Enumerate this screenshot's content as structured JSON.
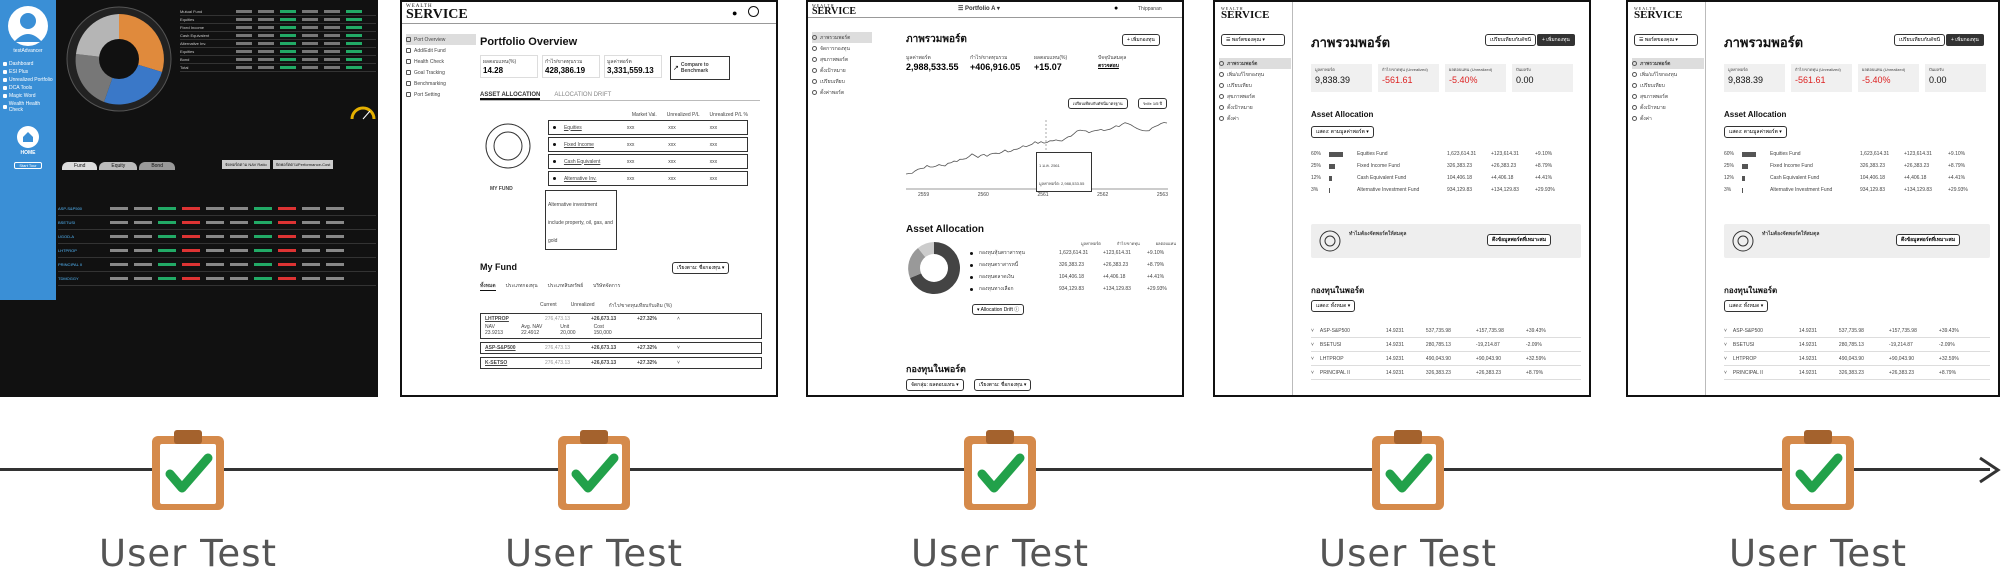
{
  "steps": [
    {
      "label": "User Test"
    },
    {
      "label": "User Test"
    },
    {
      "label": "User Test"
    },
    {
      "label": "User Test"
    },
    {
      "label": "User Test"
    }
  ],
  "colors": {
    "timeline": "#333333",
    "label_text": "#555555",
    "clipboard_body": "#d58a4b",
    "clipboard_paper": "#ffffff",
    "check": "#22a14a",
    "dark_app_bg": "#111111",
    "sidebar_blue": "#3a8fd6",
    "accent_red": "#dd2222"
  },
  "mock1": {
    "user": "testAdvancer",
    "nav": [
      "Dashboard",
      "ESI Plus",
      "Unrealized Portfolio",
      "DCA Tools",
      "Magic Word",
      "Wealth Health Check"
    ],
    "home": "HOME",
    "start_tour": "Start Tour",
    "tabs": [
      "Fund",
      "Equity",
      "Bond"
    ],
    "buttons": [
      "จัดพอร์ตตาม NAV Ratio",
      "จัดพอร์ตตามPerformance-Cost"
    ],
    "legend": [
      "Mutual Fund",
      "Equities",
      "Fixed Income",
      "Cash Equivalent",
      "Alternative Inv.",
      "Equities",
      "Bond",
      "Total"
    ],
    "funds": [
      "ASP-S&P500",
      "BSETUSI",
      "UGOD-A",
      "LHTPROP",
      "PRINCIPAL II",
      "TDMOGGY"
    ]
  },
  "mock2": {
    "logo_small": "WEALTH",
    "logo_big": "SERVICE",
    "title": "Portfolio Overview",
    "sidebar": [
      "Port Overview",
      "Add/Edit Fund",
      "Health Check",
      "Goal Tracking",
      "Benchmarking",
      "Port Setting"
    ],
    "kpis": [
      {
        "label": "ผลตอบแทน(%)",
        "value": "14.28"
      },
      {
        "label": "กำไร/ขาดทุนรวม",
        "value": "428,386.19"
      },
      {
        "label": "มูลค่าพอร์ต",
        "value": "3,331,559.13"
      }
    ],
    "compare_btn": "Compare to Benchmark",
    "tabs": [
      "ASSET ALLOCATION",
      "ALLOCATION DRIFT"
    ],
    "cols": [
      "Market Val.",
      "Unrealized P/L",
      "Unrealized P/L %"
    ],
    "assets": [
      "Equities",
      "Fixed Income",
      "Cash Equivalent",
      "Alternative Inv."
    ],
    "xxx": "xxx",
    "tooltip": "Alternative investment include property, oil, gas, and gold",
    "myfund_label": "MY FUND",
    "myfund_title": "My Fund",
    "myfund_filter": "เรียงตาม: ชื่อกองทุน",
    "myfund_tabs": [
      "ทั้งหมด",
      "ประเภทกองทุน",
      "ประเภทสินทรัพย์",
      "บริษัทจัดการ"
    ],
    "fund_cols": [
      "Current",
      "Unrealized",
      "กำไร/ขาดทุนเทียบกับเดิม (%)"
    ],
    "funds": [
      {
        "name": "LHTPROP",
        "current": "276,473.13",
        "unreal": "+26,673.13",
        "pct": "+27.32%"
      },
      {
        "name": "ASP-S&P500",
        "current": "276,473.13",
        "unreal": "+26,673.13",
        "pct": "+27.32%"
      },
      {
        "name": "K-SETSO",
        "current": "276,473.13",
        "unreal": "+26,673.13",
        "pct": "+27.32%"
      }
    ],
    "fund_detail": [
      {
        "label": "NAV",
        "value": "23.9213"
      },
      {
        "label": "Avg. NAV",
        "value": "22.4912"
      },
      {
        "label": "Unit",
        "value": "20,000"
      },
      {
        "label": "Cost",
        "value": "150,000"
      }
    ]
  },
  "mock3": {
    "logo_small": "WEALTH",
    "logo_big": "SERVICE",
    "portfolio": "Portfolio A",
    "user": "Thippanan",
    "title": "ภาพรวมพอร์ต",
    "add_btn": "+ เพิ่มกองทุน",
    "sidebar": [
      "ภาพรวมพอร์ต",
      "จัดการกองทุน",
      "สุขภาพพอร์ต",
      "ตั้งเป้าหมาย",
      "เปรียบเทียบ",
      "ตั้งค่าพอร์ต"
    ],
    "kpis": [
      {
        "label": "มูลค่าพอร์ต",
        "value": "2,988,533.55"
      },
      {
        "label": "กำไร/ขาดทุนรวม",
        "value": "+406,916.05"
      },
      {
        "label": "ผลตอบแทน(%)",
        "value": "+15.07"
      },
      {
        "label": "ปัจจุบันสมดุล",
        "value": "ตรวจสอบ"
      }
    ],
    "compare_btn": "เปรียบเทียบกับดัชนีมาตรฐาน",
    "period": "ระยะ 1/5 ปี",
    "years": [
      "2559",
      "2560",
      "2561",
      "2562",
      "2563"
    ],
    "tooltip": "1 ม.ค. 2561\nมูลค่าพอร์ต: 2,988,533.55",
    "alloc_title": "Asset Allocation",
    "alloc_cols": [
      "มูลค่าพอร์ต",
      "กำไร/ขาดทุน",
      "ผลตอบแทน"
    ],
    "alloc_rows": [
      {
        "name": "กองทุนหุ้นตราสารทุน",
        "value": "1,623,614.31",
        "pl": "+123,614.31",
        "pct": "+9.10%"
      },
      {
        "name": "กองทุนตราสารหนี้",
        "value": "326,383.23",
        "pl": "+26,383.23",
        "pct": "+8.79%"
      },
      {
        "name": "กองทุนตลาดเงิน",
        "value": "104,406.18",
        "pl": "+4,406.18",
        "pct": "+4.41%"
      },
      {
        "name": "กองทุนทางเลือก",
        "value": "934,129.83",
        "pl": "+134,129.83",
        "pct": "+29.93%"
      }
    ],
    "drift": "Allocation Drift",
    "funds_title": "กองทุนในพอร์ต",
    "filters": [
      "จัดกลุ่ม: ผลตอบแทน",
      "เรียงตาม: ชื่อกองทุน"
    ]
  },
  "mock4": {
    "logo_small": "WEALTH",
    "logo_big": "SERVICE",
    "port_select": "พอร์ตของคุณ",
    "title": "ภาพรวมพอร์ต",
    "compare_btn": "เปรียบเทียบกับดัชนี",
    "add_btn": "+ เพิ่มกองทุน",
    "sidebar": [
      "ภาพรวมพอร์ต",
      "เพิ่ม/แก้ไขกองทุน",
      "เปรียบเทียบ",
      "สุขภาพพอร์ต",
      "ตั้งเป้าหมาย",
      "ตั้งค่า"
    ],
    "kpis": [
      {
        "label": "มูลค่าพอร์ต",
        "value": "9,838.39",
        "red": false
      },
      {
        "label": "กำไร/ขาดทุน (Unrealized)",
        "value": "-561.61",
        "red": true
      },
      {
        "label": "ผลตอบแทน (Unrealized)",
        "value": "-5.40%",
        "red": true
      },
      {
        "label": "ปันผลรับ",
        "value": "0.00",
        "red": false
      }
    ],
    "alloc_title": "Asset Allocation",
    "alloc_filter": "แสดง: ตามมูลค่าพอร์ต",
    "alloc_rows": [
      {
        "pct": "60%",
        "name": "Equities Fund",
        "value": "1,623,614.31",
        "pl": "+123,614.31",
        "ret": "+9.10%",
        "bar": 0.6
      },
      {
        "pct": "25%",
        "name": "Fixed Income Fund",
        "value": "326,383.23",
        "pl": "+26,383.23",
        "ret": "+8.79%",
        "bar": 0.25
      },
      {
        "pct": "12%",
        "name": "Cash Equivalent Fund",
        "value": "104,406.18",
        "pl": "+4,406.18",
        "ret": "+4.41%",
        "bar": 0.12
      },
      {
        "pct": "3%",
        "name": "Alternative Investment Fund",
        "value": "934,129.83",
        "pl": "+134,129.83",
        "ret": "+29.93%",
        "bar": 0.03
      }
    ],
    "banner_title": "ทำไมต้องจัดพอร์ตให้สมดุล",
    "banner_btn": "ดึงข้อมูลพอร์ตที่เหมาะสม",
    "funds_title": "กองทุนในพอร์ต",
    "funds_filter": "แสดง: ทั้งหมด",
    "funds": [
      {
        "name": "ASP-S&P500",
        "nav": "14.9231",
        "cost": "537,735.98",
        "pl": "+157,735.98",
        "pct": "+39.43%"
      },
      {
        "name": "BSETUSI",
        "nav": "14.9231",
        "cost": "280,785.13",
        "pl": "-19,214.87",
        "pct": "-2.09%"
      },
      {
        "name": "LHTPROP",
        "nav": "14.9231",
        "cost": "490,043.90",
        "pl": "+90,043.90",
        "pct": "+32.59%"
      },
      {
        "name": "PRINCIPAL II",
        "nav": "14.9231",
        "cost": "326,383.23",
        "pl": "+26,383.23",
        "pct": "+8.79%"
      }
    ]
  },
  "mock5": {
    "logo_small": "WEALTH",
    "logo_big": "SERVICE",
    "port_select": "พอร์ตของคุณ",
    "title": "ภาพรวมพอร์ต",
    "compare_btn": "เปรียบเทียบกับดัชนี",
    "add_btn": "+ เพิ่มกองทุน",
    "sidebar": [
      "ภาพรวมพอร์ต",
      "เพิ่ม/แก้ไขกองทุน",
      "เปรียบเทียบ",
      "สุขภาพพอร์ต",
      "ตั้งเป้าหมาย",
      "ตั้งค่า"
    ],
    "kpis": [
      {
        "label": "มูลค่าพอร์ต",
        "value": "9,838.39",
        "red": false
      },
      {
        "label": "กำไร/ขาดทุน (Unrealized)",
        "value": "-561.61",
        "red": true
      },
      {
        "label": "ผลตอบแทน (Unrealized)",
        "value": "-5.40%",
        "red": true
      },
      {
        "label": "ปันผลรับ",
        "value": "0.00",
        "red": false
      }
    ],
    "alloc_title": "Asset Allocation",
    "alloc_filter": "แสดง: ตามมูลค่าพอร์ต",
    "alloc_rows": [
      {
        "pct": "60%",
        "name": "Equities Fund",
        "value": "1,623,614.31",
        "pl": "+123,614.31",
        "ret": "+9.10%",
        "bar": 0.6
      },
      {
        "pct": "25%",
        "name": "Fixed Income Fund",
        "value": "326,383.23",
        "pl": "+26,383.23",
        "ret": "+8.79%",
        "bar": 0.25
      },
      {
        "pct": "12%",
        "name": "Cash Equivalent Fund",
        "value": "104,406.18",
        "pl": "+4,406.18",
        "ret": "+4.41%",
        "bar": 0.12
      },
      {
        "pct": "3%",
        "name": "Alternative Investment Fund",
        "value": "934,129.83",
        "pl": "+134,129.83",
        "ret": "+29.93%",
        "bar": 0.03
      }
    ],
    "banner_title": "ทำไมต้องจัดพอร์ตให้สมดุล",
    "banner_btn": "ดึงข้อมูลพอร์ตที่เหมาะสม",
    "funds_title": "กองทุนในพอร์ต",
    "funds_filter": "แสดง: ทั้งหมด",
    "funds": [
      {
        "name": "ASP-S&P500",
        "nav": "14.9231",
        "cost": "537,735.98",
        "pl": "+157,735.98",
        "pct": "+39.43%"
      },
      {
        "name": "BSETUSI",
        "nav": "14.9231",
        "cost": "280,785.13",
        "pl": "-19,214.87",
        "pct": "-2.09%"
      },
      {
        "name": "LHTPROP",
        "nav": "14.9231",
        "cost": "490,043.90",
        "pl": "+90,043.90",
        "pct": "+32.59%"
      },
      {
        "name": "PRINCIPAL II",
        "nav": "14.9231",
        "cost": "326,383.23",
        "pl": "+26,383.23",
        "pct": "+8.79%"
      }
    ]
  }
}
